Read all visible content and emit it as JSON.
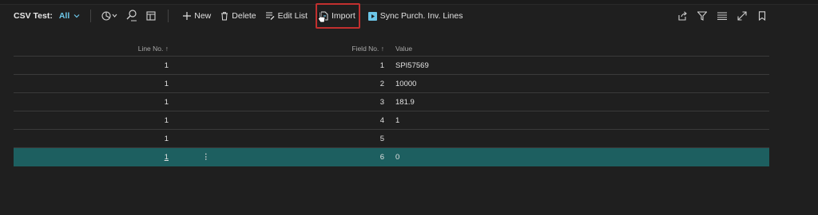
{
  "toolbar": {
    "title": "CSV Test:",
    "view": "All",
    "new_label": "New",
    "delete_label": "Delete",
    "edit_list_label": "Edit List",
    "import_label": "Import",
    "sync_label": "Sync Purch. Inv. Lines"
  },
  "grid": {
    "columns": [
      "Line No. ↑",
      "Field No. ↑",
      "Value"
    ],
    "rows": [
      {
        "line": "1",
        "field": "1",
        "value": "SPI57569"
      },
      {
        "line": "1",
        "field": "2",
        "value": "10000"
      },
      {
        "line": "1",
        "field": "3",
        "value": "181.9"
      },
      {
        "line": "1",
        "field": "4",
        "value": "1"
      },
      {
        "line": "1",
        "field": "5",
        "value": ""
      },
      {
        "line": "1",
        "field": "6",
        "value": "0"
      }
    ],
    "selected_row": 6
  },
  "colors": {
    "accent": "#6cc6e8",
    "selected": "#1d5f60",
    "highlight": "#c2302f"
  }
}
